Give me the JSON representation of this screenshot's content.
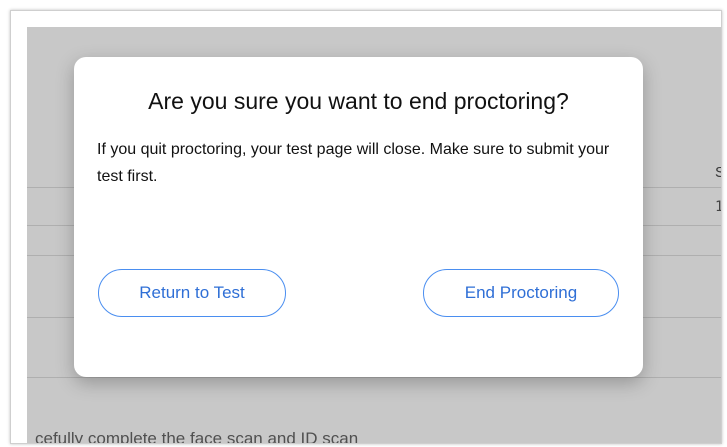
{
  "background": {
    "column_header": "S",
    "cell_value": "1",
    "bottom_text": "cefully complete the face scan and ID scan"
  },
  "dialog": {
    "title": "Are you sure you want to end proctoring?",
    "message": "If you quit proctoring, your test page will close. Make sure to submit your test first.",
    "return_button": "Return to Test",
    "end_button": "End Proctoring"
  },
  "colors": {
    "accent": "#2f6fd6",
    "button_border": "#4a8ef0",
    "overlay": "#464646"
  }
}
